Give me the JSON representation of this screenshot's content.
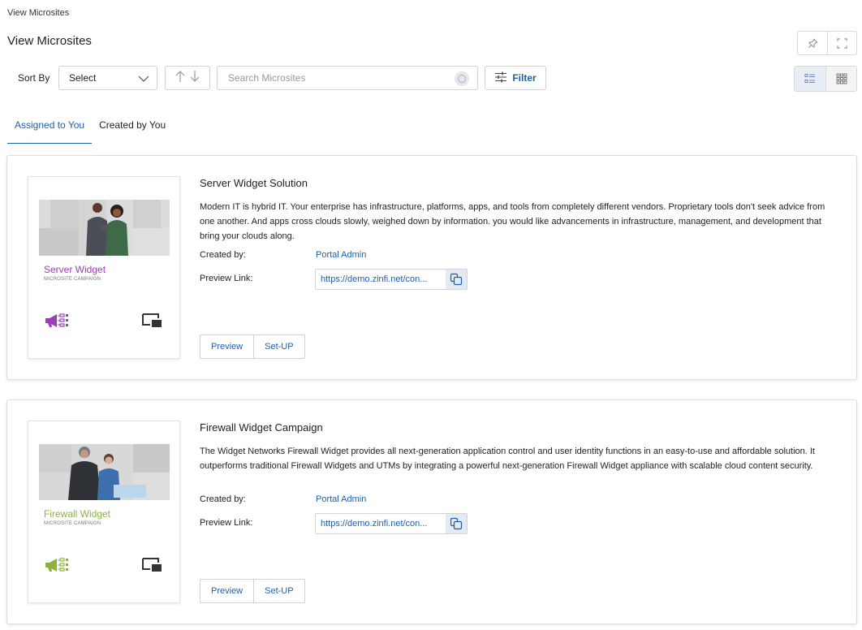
{
  "breadcrumb": "View Microsites",
  "page_title": "View Microsites",
  "toolbar": {
    "sort_label": "Sort By",
    "sort_value": "Select",
    "search_placeholder": "Search Microsites",
    "filter_label": "Filter"
  },
  "tabs": [
    {
      "label": "Assigned to You",
      "active": true
    },
    {
      "label": "Created by You",
      "active": false
    }
  ],
  "labels": {
    "created_by": "Created by:",
    "preview_link": "Preview Link:",
    "preview_btn": "Preview",
    "setup_btn": "Set-UP"
  },
  "cards": [
    {
      "title": "Server Widget Solution",
      "description": "Modern IT is hybrid IT. Your enterprise has infrastructure, platforms, apps, and tools from completely different vendors. Proprietary tools don't seek advice from one another. And apps cross clouds slowly, weighed down by information. you would like advancements in infrastructure, management, and development that bring your clouds along.",
      "created_by": "Portal Admin",
      "preview_link": "https://demo.zinfi.net/con...",
      "thumb_name": "Server Widget",
      "thumb_sub": "MICROSITE CAMPAIGN",
      "accent": "#9b3fb5"
    },
    {
      "title": "Firewall Widget Campaign",
      "description": "The Widget Networks Firewall Widget provides all next-generation application control and user identity functions in an easy-to-use and affordable solution. It outperforms traditional Firewall Widgets and UTMs by integrating a powerful next-generation Firewall Widget appliance with scalable cloud content security.",
      "created_by": "Portal Admin",
      "preview_link": "https://demo.zinfi.net/con...",
      "thumb_name": "Firewall Widget",
      "thumb_sub": "MICROSITE CAMPAIGN",
      "accent": "#8cb43a"
    }
  ],
  "colors": {
    "link": "#1f5fa8"
  }
}
